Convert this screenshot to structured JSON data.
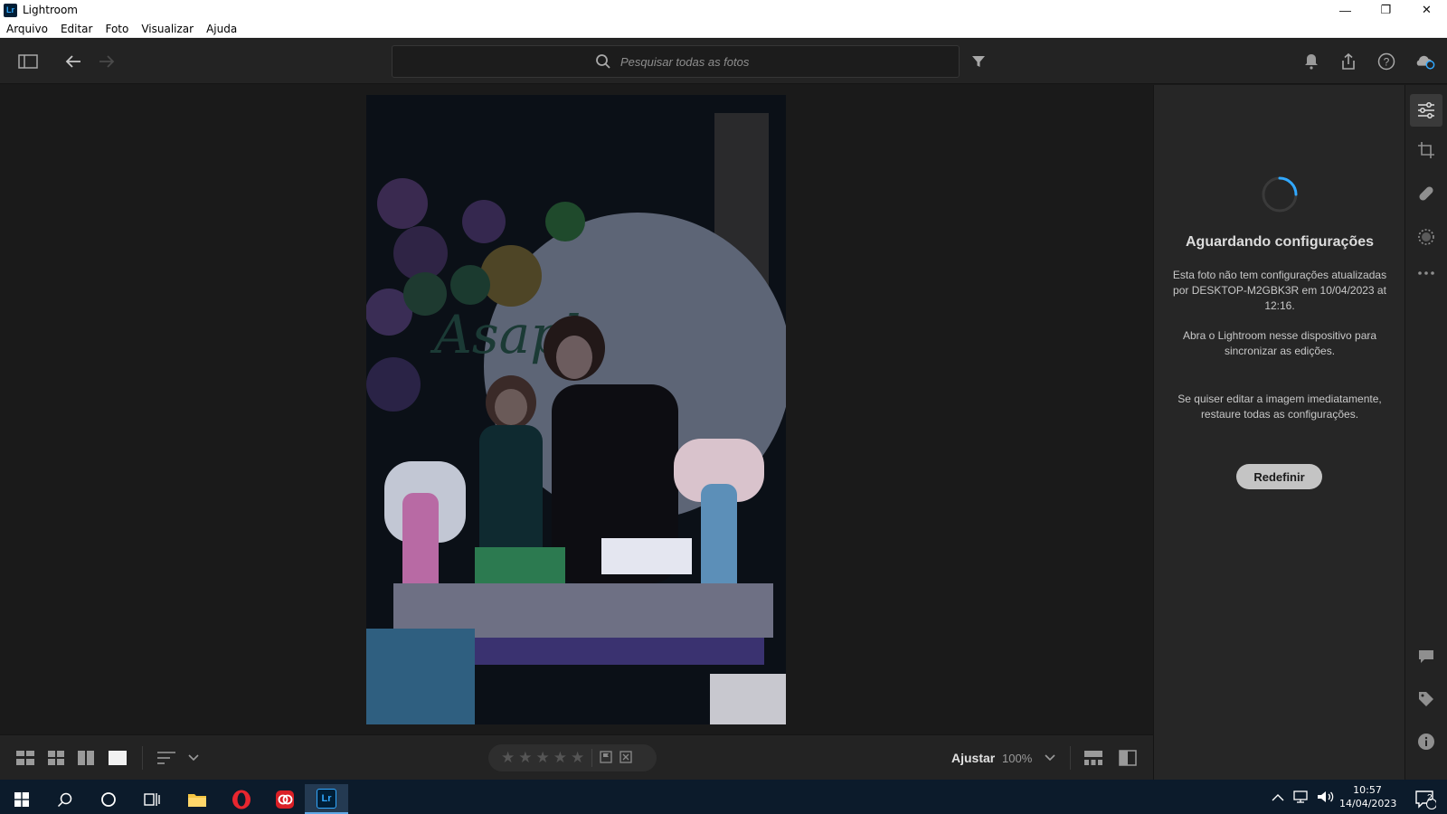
{
  "window": {
    "title": "Lightroom",
    "logo_text": "Lr",
    "minimize": "—",
    "restore": "❐",
    "close": "✕"
  },
  "menu": [
    "Arquivo",
    "Editar",
    "Foto",
    "Visualizar",
    "Ajuda"
  ],
  "search": {
    "placeholder": "Pesquisar todas as fotos",
    "value": ""
  },
  "sync_panel": {
    "title": "Aguardando configurações",
    "message1": "Esta foto não tem configurações atualizadas por DESKTOP-M2GBK3R em 10/04/2023 at 12:16.",
    "message2": "Abra o Lightroom nesse dispositivo para sincronizar as edições.",
    "message3": "Se quiser editar a imagem imediatamente, restaure todas as configurações.",
    "reset_label": "Redefinir"
  },
  "bottom": {
    "zoom_label": "Ajustar",
    "zoom_value": "100%",
    "rating": 0,
    "stars": [
      "★",
      "★",
      "★",
      "★",
      "★"
    ]
  },
  "photo": {
    "caption_text": "Asaph"
  },
  "taskbar": {
    "time": "10:57",
    "date": "14/04/2023",
    "notification_count": "2",
    "lr_label": "Lr"
  },
  "colors": {
    "accent": "#31a8ff",
    "panel_bg": "#262626",
    "canvas_bg": "#1a1a1a",
    "taskbar_bg": "#0c1b2b"
  },
  "icons": {
    "toolbar": [
      "panel-toggle-icon",
      "back-arrow-icon",
      "forward-arrow-icon",
      "search-icon",
      "filter-icon",
      "bell-icon",
      "share-icon",
      "help-icon",
      "cloud-sync-icon"
    ],
    "rail": [
      "edit-sliders-icon",
      "crop-icon",
      "healing-bandage-icon",
      "masking-icon",
      "more-icon",
      "comment-icon",
      "tag-icon",
      "info-icon"
    ]
  }
}
